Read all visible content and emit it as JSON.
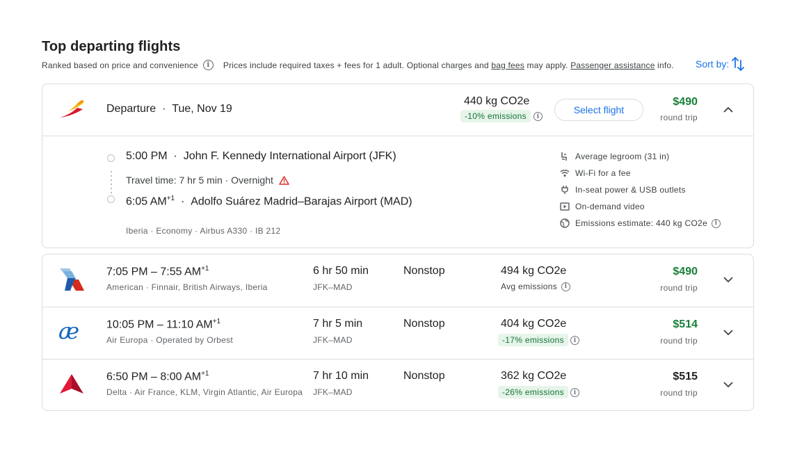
{
  "header": {
    "title": "Top departing flights",
    "ranked_text": "Ranked based on price and convenience",
    "prices_text": "Prices include required taxes + fees for 1 adult. Optional charges and",
    "bag_fees_link": "bag fees",
    "may_apply": "may apply.",
    "passenger_assistance_link": "Passenger assistance",
    "info_suffix": "info.",
    "sort_label": "Sort by:"
  },
  "expanded": {
    "departure_label": "Departure",
    "date": "Tue, Nov 19",
    "co2": "440 kg CO2e",
    "emissions_badge": "-10% emissions",
    "select_button": "Select flight",
    "price": "$490",
    "price_sub": "round trip",
    "depart_time": "5:00 PM",
    "depart_airport": "John F. Kennedy International Airport (JFK)",
    "travel_time": "Travel time: 7 hr 5 min · Overnight",
    "arrive_time": "6:05 AM",
    "arrive_plus": "+1",
    "arrive_airport": "Adolfo Suárez Madrid–Barajas Airport (MAD)",
    "meta": "Iberia · Economy · Airbus A330 · IB 212",
    "amenities": [
      {
        "icon": "legroom-icon",
        "label": "Average legroom (31 in)"
      },
      {
        "icon": "wifi-icon",
        "label": "Wi-Fi for a fee"
      },
      {
        "icon": "power-plug-icon",
        "label": "In-seat power & USB outlets"
      },
      {
        "icon": "video-icon",
        "label": "On-demand video"
      },
      {
        "icon": "globe-icon",
        "label": "Emissions estimate: 440 kg CO2e"
      }
    ]
  },
  "flights": [
    {
      "times": "7:05 PM – 7:55 AM",
      "plus": "+1",
      "airline": "American · Finnair, British Airways, Iberia",
      "duration": "6 hr 50 min",
      "route": "JFK–MAD",
      "stops": "Nonstop",
      "co2": "494 kg CO2e",
      "emissions": "Avg emissions",
      "price": "$490",
      "price_sub": "round trip"
    },
    {
      "times": "10:05 PM – 11:10 AM",
      "plus": "+1",
      "airline": "Air Europa · Operated by Orbest",
      "duration": "7 hr 5 min",
      "route": "JFK–MAD",
      "stops": "Nonstop",
      "co2": "404 kg CO2e",
      "emissions": "-17% emissions",
      "price": "$514",
      "price_sub": "round trip"
    },
    {
      "times": "6:50 PM – 8:00 AM",
      "plus": "+1",
      "airline": "Delta · Air France, KLM, Virgin Atlantic, Air Europa",
      "duration": "7 hr 10 min",
      "route": "JFK–MAD",
      "stops": "Nonstop",
      "co2": "362 kg CO2e",
      "emissions": "-26% emissions",
      "price": "$515",
      "price_sub": "round trip"
    }
  ],
  "colors": {
    "accent_blue": "#1a73e8",
    "price_green": "#188038",
    "emissions_bg": "#e6f4ea",
    "emissions_text": "#137333",
    "warning_red": "#d93025"
  },
  "icons": {
    "lowest_fare_info": "i"
  }
}
